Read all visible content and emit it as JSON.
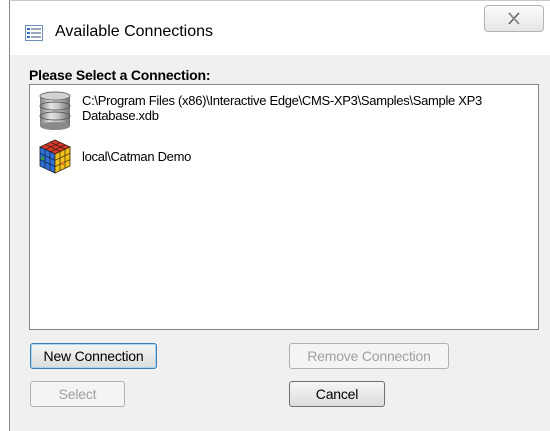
{
  "window": {
    "title": "Available Connections",
    "title_icon": "list-window-icon",
    "close_icon": "close-x-icon"
  },
  "connections": {
    "group_label": "Please Select a Connection:",
    "items": [
      {
        "label": "C:\\Program Files (x86)\\Interactive Edge\\CMS-XP3\\Samples\\Sample XP3 Database.xdb",
        "icon": "database-cylinder-icon"
      },
      {
        "label": "local\\Catman Demo",
        "icon": "rubik-cube-icon"
      }
    ]
  },
  "buttons": {
    "new_connection": "New Connection",
    "remove_connection": "Remove Connection",
    "select": "Select",
    "cancel": "Cancel"
  },
  "colors": {
    "window_bg": "#f0f0f0",
    "list_border": "#828790",
    "disabled_text": "#a0a0a0",
    "focus_border": "#3c7fb1"
  }
}
